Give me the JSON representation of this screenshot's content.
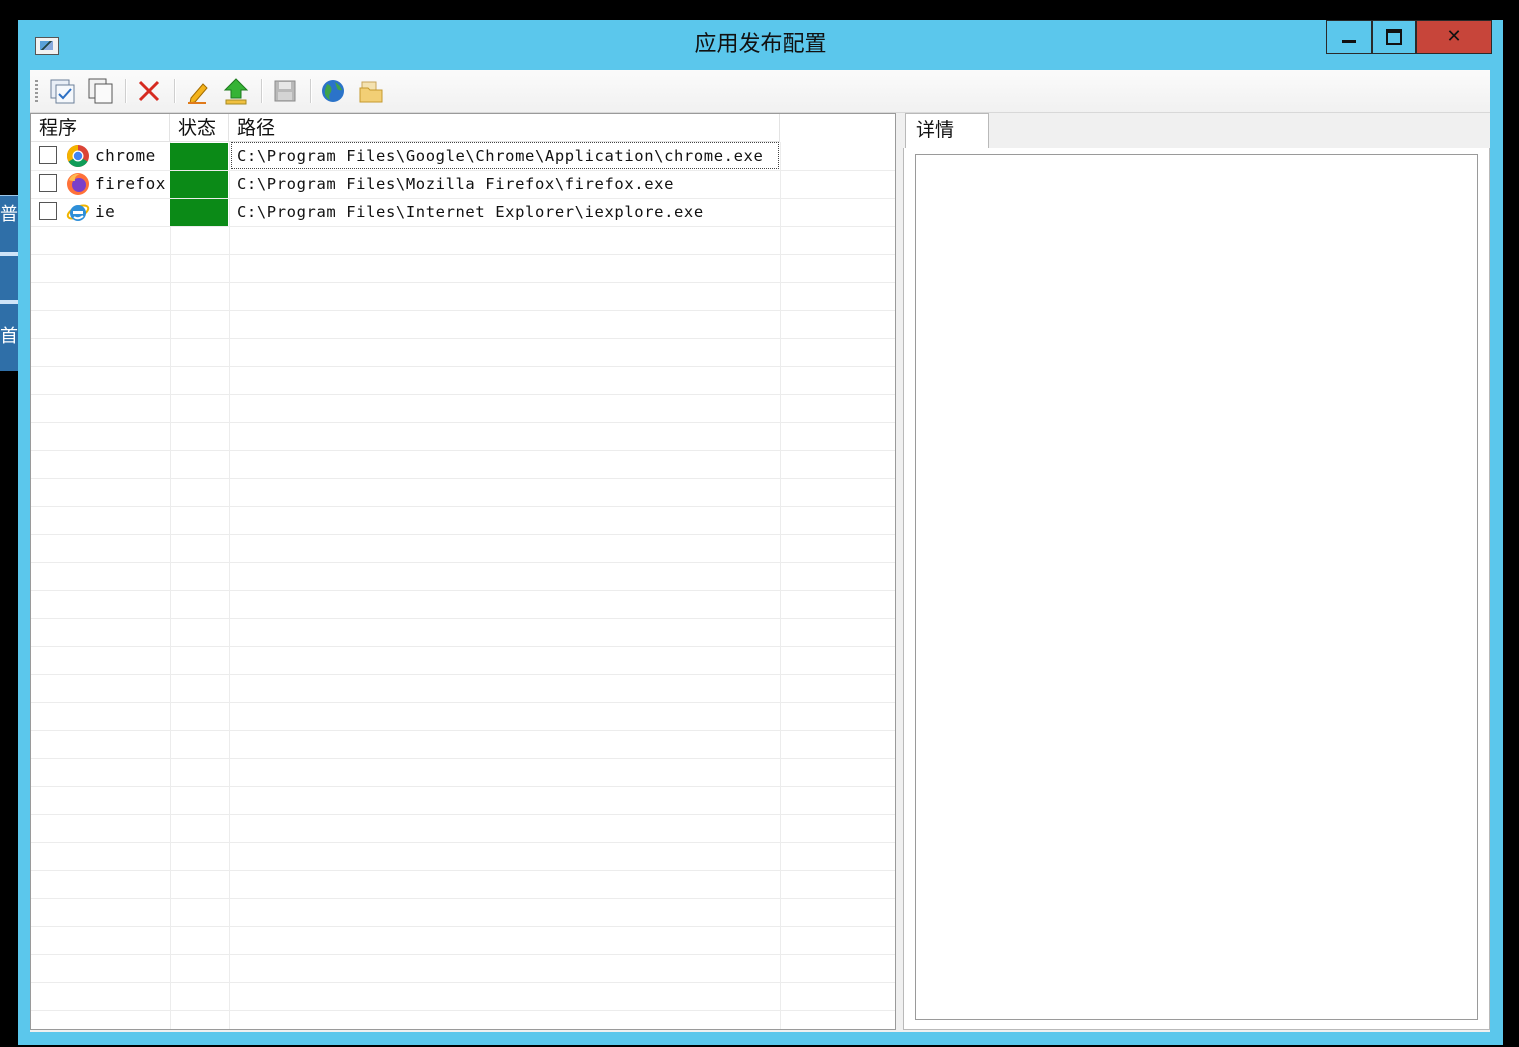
{
  "background": {
    "left_strip_glyphs": [
      "普",
      "首"
    ]
  },
  "window": {
    "title": "应用发布配置",
    "icon": "app-window-icon"
  },
  "toolbar": {
    "buttons": [
      {
        "icon": "new-checked-doc-icon"
      },
      {
        "icon": "copy-icon"
      },
      {
        "icon": "delete-icon"
      },
      {
        "icon": "edit-pencil-icon"
      },
      {
        "icon": "publish-up-arrow-icon"
      },
      {
        "icon": "save-disk-icon"
      },
      {
        "icon": "globe-icon"
      },
      {
        "icon": "folder-icon"
      }
    ]
  },
  "list": {
    "columns": [
      "程序",
      "状态",
      "路径"
    ],
    "rows": [
      {
        "name": "chrome",
        "icon": "chrome-icon",
        "status_color": "#0b8a17",
        "path": "C:\\Program Files\\Google\\Chrome\\Application\\chrome.exe"
      },
      {
        "name": "firefox",
        "icon": "firefox-icon",
        "status_color": "#0b8a17",
        "path": "C:\\Program Files\\Mozilla Firefox\\firefox.exe"
      },
      {
        "name": "ie",
        "icon": "ie-icon",
        "status_color": "#0b8a17",
        "path": "C:\\Program Files\\Internet Explorer\\iexplore.exe"
      }
    ]
  },
  "details": {
    "tab_label": "详情"
  },
  "colors": {
    "titlebar": "#5bc7ec",
    "close_button": "#c7453a",
    "status_ok": "#0b8a17"
  }
}
